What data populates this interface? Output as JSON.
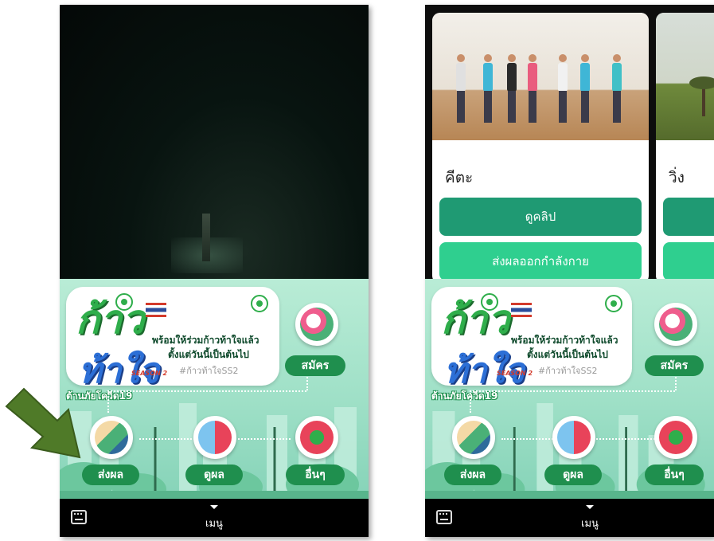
{
  "left_screen": {
    "banner": {
      "logo_top": "ก้าว",
      "logo_bottom": "ท้าใจ",
      "season": "SEASON 2",
      "tagline_line1": "พร้อมให้ร่วมก้าวท้าใจแล้ว",
      "tagline_line2": "ตั้งแต่วันนี้เป็นต้นไป",
      "hashtag": "#ก้าวท้าใจSS2",
      "covid": "ต้านภัยโควิด19"
    },
    "register_label": "สมัคร",
    "send_results_label": "ส่งผล",
    "view_results_label": "ดูผล",
    "other_label": "อื่นๆ",
    "menu_label": "เมนู"
  },
  "right_screen": {
    "cards": [
      {
        "title": "คีตะ",
        "watch_clip_label": "ดูคลิป",
        "submit_exercise_label": "ส่งผลออกกำลังกาย"
      },
      {
        "title": "วิ่ง"
      }
    ],
    "banner": {
      "logo_top": "ก้าว",
      "logo_bottom": "ท้าใจ",
      "season": "SEASON 2",
      "tagline_line1": "พร้อมให้ร่วมก้าวท้าใจแล้ว",
      "tagline_line2": "ตั้งแต่วันนี้เป็นต้นไป",
      "hashtag": "#ก้าวท้าใจSS2",
      "covid": "ต้านภัยโควิด19"
    },
    "register_label": "สมัคร",
    "send_results_label": "ส่งผล",
    "view_results_label": "ดูผล",
    "other_label": "อื่นๆ",
    "menu_label": "เมนู"
  },
  "colors": {
    "panel_green": "#9fe0c7",
    "pill_green": "#1f8f4e",
    "button_dark": "#1f9a73",
    "button_light": "#2fcf8f",
    "annotation_arrow": "#4f7a28"
  },
  "icons": {
    "register": "running-shoe-icon",
    "send_results": "smartwatch-icon",
    "view_results": "heart-chart-icon",
    "other": "running-track-icon",
    "keyboard": "keyboard-icon"
  }
}
